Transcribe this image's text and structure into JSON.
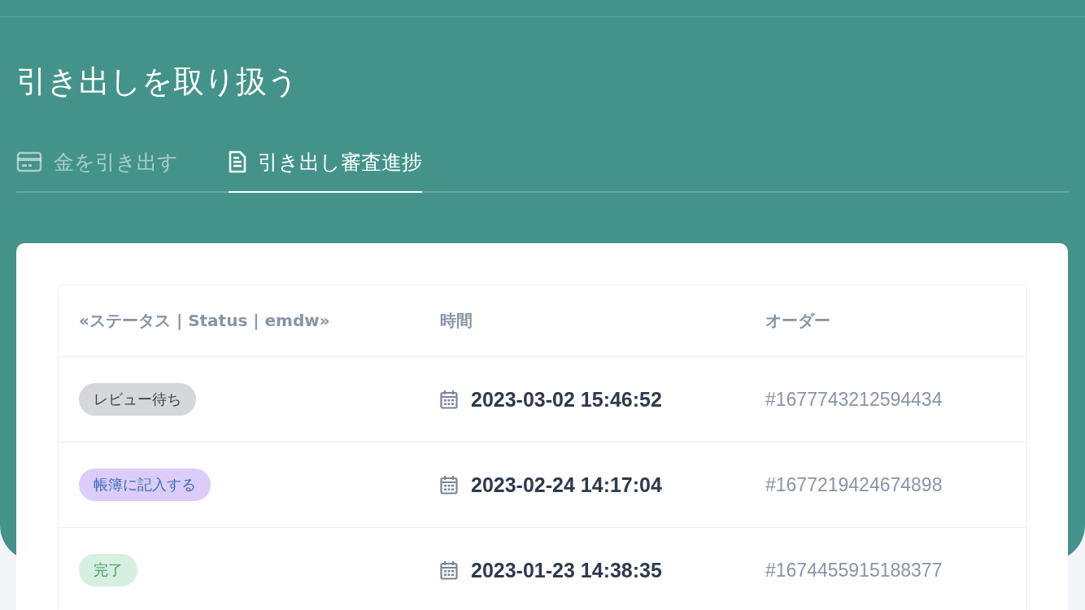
{
  "page": {
    "title": "引き出しを取り扱う"
  },
  "tabs": [
    {
      "label": "金を引き出す",
      "kind": "card",
      "selected": false
    },
    {
      "label": "引き出し審査進捗",
      "kind": "document",
      "selected": true
    }
  ],
  "table": {
    "columns": [
      "«ステータス | Status | emdw»",
      "時間",
      "オーダー"
    ],
    "rows": [
      {
        "status": {
          "label": "レビュー待ち",
          "kind": "pending"
        },
        "time": "2023-03-02 15:46:52",
        "order": "#1677743212594434"
      },
      {
        "status": {
          "label": "帳簿に記入する",
          "kind": "ledger"
        },
        "time": "2023-02-24 14:17:04",
        "order": "#1677219424674898"
      },
      {
        "status": {
          "label": "完了",
          "kind": "done"
        },
        "time": "2023-01-23 14:38:35",
        "order": "#1674455915188377"
      }
    ]
  }
}
